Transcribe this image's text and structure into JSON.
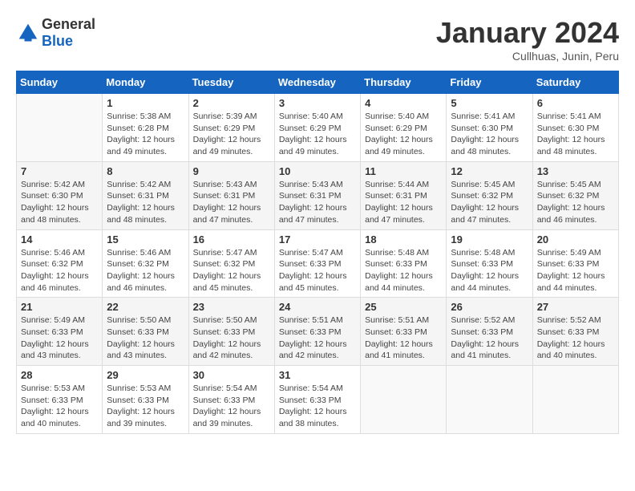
{
  "header": {
    "logo_general": "General",
    "logo_blue": "Blue",
    "month_title": "January 2024",
    "location": "Cullhuas, Junin, Peru"
  },
  "weekdays": [
    "Sunday",
    "Monday",
    "Tuesday",
    "Wednesday",
    "Thursday",
    "Friday",
    "Saturday"
  ],
  "weeks": [
    [
      {
        "day": "",
        "sunrise": "",
        "sunset": "",
        "daylight": ""
      },
      {
        "day": "1",
        "sunrise": "Sunrise: 5:38 AM",
        "sunset": "Sunset: 6:28 PM",
        "daylight": "Daylight: 12 hours and 49 minutes."
      },
      {
        "day": "2",
        "sunrise": "Sunrise: 5:39 AM",
        "sunset": "Sunset: 6:29 PM",
        "daylight": "Daylight: 12 hours and 49 minutes."
      },
      {
        "day": "3",
        "sunrise": "Sunrise: 5:40 AM",
        "sunset": "Sunset: 6:29 PM",
        "daylight": "Daylight: 12 hours and 49 minutes."
      },
      {
        "day": "4",
        "sunrise": "Sunrise: 5:40 AM",
        "sunset": "Sunset: 6:29 PM",
        "daylight": "Daylight: 12 hours and 49 minutes."
      },
      {
        "day": "5",
        "sunrise": "Sunrise: 5:41 AM",
        "sunset": "Sunset: 6:30 PM",
        "daylight": "Daylight: 12 hours and 48 minutes."
      },
      {
        "day": "6",
        "sunrise": "Sunrise: 5:41 AM",
        "sunset": "Sunset: 6:30 PM",
        "daylight": "Daylight: 12 hours and 48 minutes."
      }
    ],
    [
      {
        "day": "7",
        "sunrise": "Sunrise: 5:42 AM",
        "sunset": "Sunset: 6:30 PM",
        "daylight": "Daylight: 12 hours and 48 minutes."
      },
      {
        "day": "8",
        "sunrise": "Sunrise: 5:42 AM",
        "sunset": "Sunset: 6:31 PM",
        "daylight": "Daylight: 12 hours and 48 minutes."
      },
      {
        "day": "9",
        "sunrise": "Sunrise: 5:43 AM",
        "sunset": "Sunset: 6:31 PM",
        "daylight": "Daylight: 12 hours and 47 minutes."
      },
      {
        "day": "10",
        "sunrise": "Sunrise: 5:43 AM",
        "sunset": "Sunset: 6:31 PM",
        "daylight": "Daylight: 12 hours and 47 minutes."
      },
      {
        "day": "11",
        "sunrise": "Sunrise: 5:44 AM",
        "sunset": "Sunset: 6:31 PM",
        "daylight": "Daylight: 12 hours and 47 minutes."
      },
      {
        "day": "12",
        "sunrise": "Sunrise: 5:45 AM",
        "sunset": "Sunset: 6:32 PM",
        "daylight": "Daylight: 12 hours and 47 minutes."
      },
      {
        "day": "13",
        "sunrise": "Sunrise: 5:45 AM",
        "sunset": "Sunset: 6:32 PM",
        "daylight": "Daylight: 12 hours and 46 minutes."
      }
    ],
    [
      {
        "day": "14",
        "sunrise": "Sunrise: 5:46 AM",
        "sunset": "Sunset: 6:32 PM",
        "daylight": "Daylight: 12 hours and 46 minutes."
      },
      {
        "day": "15",
        "sunrise": "Sunrise: 5:46 AM",
        "sunset": "Sunset: 6:32 PM",
        "daylight": "Daylight: 12 hours and 46 minutes."
      },
      {
        "day": "16",
        "sunrise": "Sunrise: 5:47 AM",
        "sunset": "Sunset: 6:32 PM",
        "daylight": "Daylight: 12 hours and 45 minutes."
      },
      {
        "day": "17",
        "sunrise": "Sunrise: 5:47 AM",
        "sunset": "Sunset: 6:33 PM",
        "daylight": "Daylight: 12 hours and 45 minutes."
      },
      {
        "day": "18",
        "sunrise": "Sunrise: 5:48 AM",
        "sunset": "Sunset: 6:33 PM",
        "daylight": "Daylight: 12 hours and 44 minutes."
      },
      {
        "day": "19",
        "sunrise": "Sunrise: 5:48 AM",
        "sunset": "Sunset: 6:33 PM",
        "daylight": "Daylight: 12 hours and 44 minutes."
      },
      {
        "day": "20",
        "sunrise": "Sunrise: 5:49 AM",
        "sunset": "Sunset: 6:33 PM",
        "daylight": "Daylight: 12 hours and 44 minutes."
      }
    ],
    [
      {
        "day": "21",
        "sunrise": "Sunrise: 5:49 AM",
        "sunset": "Sunset: 6:33 PM",
        "daylight": "Daylight: 12 hours and 43 minutes."
      },
      {
        "day": "22",
        "sunrise": "Sunrise: 5:50 AM",
        "sunset": "Sunset: 6:33 PM",
        "daylight": "Daylight: 12 hours and 43 minutes."
      },
      {
        "day": "23",
        "sunrise": "Sunrise: 5:50 AM",
        "sunset": "Sunset: 6:33 PM",
        "daylight": "Daylight: 12 hours and 42 minutes."
      },
      {
        "day": "24",
        "sunrise": "Sunrise: 5:51 AM",
        "sunset": "Sunset: 6:33 PM",
        "daylight": "Daylight: 12 hours and 42 minutes."
      },
      {
        "day": "25",
        "sunrise": "Sunrise: 5:51 AM",
        "sunset": "Sunset: 6:33 PM",
        "daylight": "Daylight: 12 hours and 41 minutes."
      },
      {
        "day": "26",
        "sunrise": "Sunrise: 5:52 AM",
        "sunset": "Sunset: 6:33 PM",
        "daylight": "Daylight: 12 hours and 41 minutes."
      },
      {
        "day": "27",
        "sunrise": "Sunrise: 5:52 AM",
        "sunset": "Sunset: 6:33 PM",
        "daylight": "Daylight: 12 hours and 40 minutes."
      }
    ],
    [
      {
        "day": "28",
        "sunrise": "Sunrise: 5:53 AM",
        "sunset": "Sunset: 6:33 PM",
        "daylight": "Daylight: 12 hours and 40 minutes."
      },
      {
        "day": "29",
        "sunrise": "Sunrise: 5:53 AM",
        "sunset": "Sunset: 6:33 PM",
        "daylight": "Daylight: 12 hours and 39 minutes."
      },
      {
        "day": "30",
        "sunrise": "Sunrise: 5:54 AM",
        "sunset": "Sunset: 6:33 PM",
        "daylight": "Daylight: 12 hours and 39 minutes."
      },
      {
        "day": "31",
        "sunrise": "Sunrise: 5:54 AM",
        "sunset": "Sunset: 6:33 PM",
        "daylight": "Daylight: 12 hours and 38 minutes."
      },
      {
        "day": "",
        "sunrise": "",
        "sunset": "",
        "daylight": ""
      },
      {
        "day": "",
        "sunrise": "",
        "sunset": "",
        "daylight": ""
      },
      {
        "day": "",
        "sunrise": "",
        "sunset": "",
        "daylight": ""
      }
    ]
  ]
}
